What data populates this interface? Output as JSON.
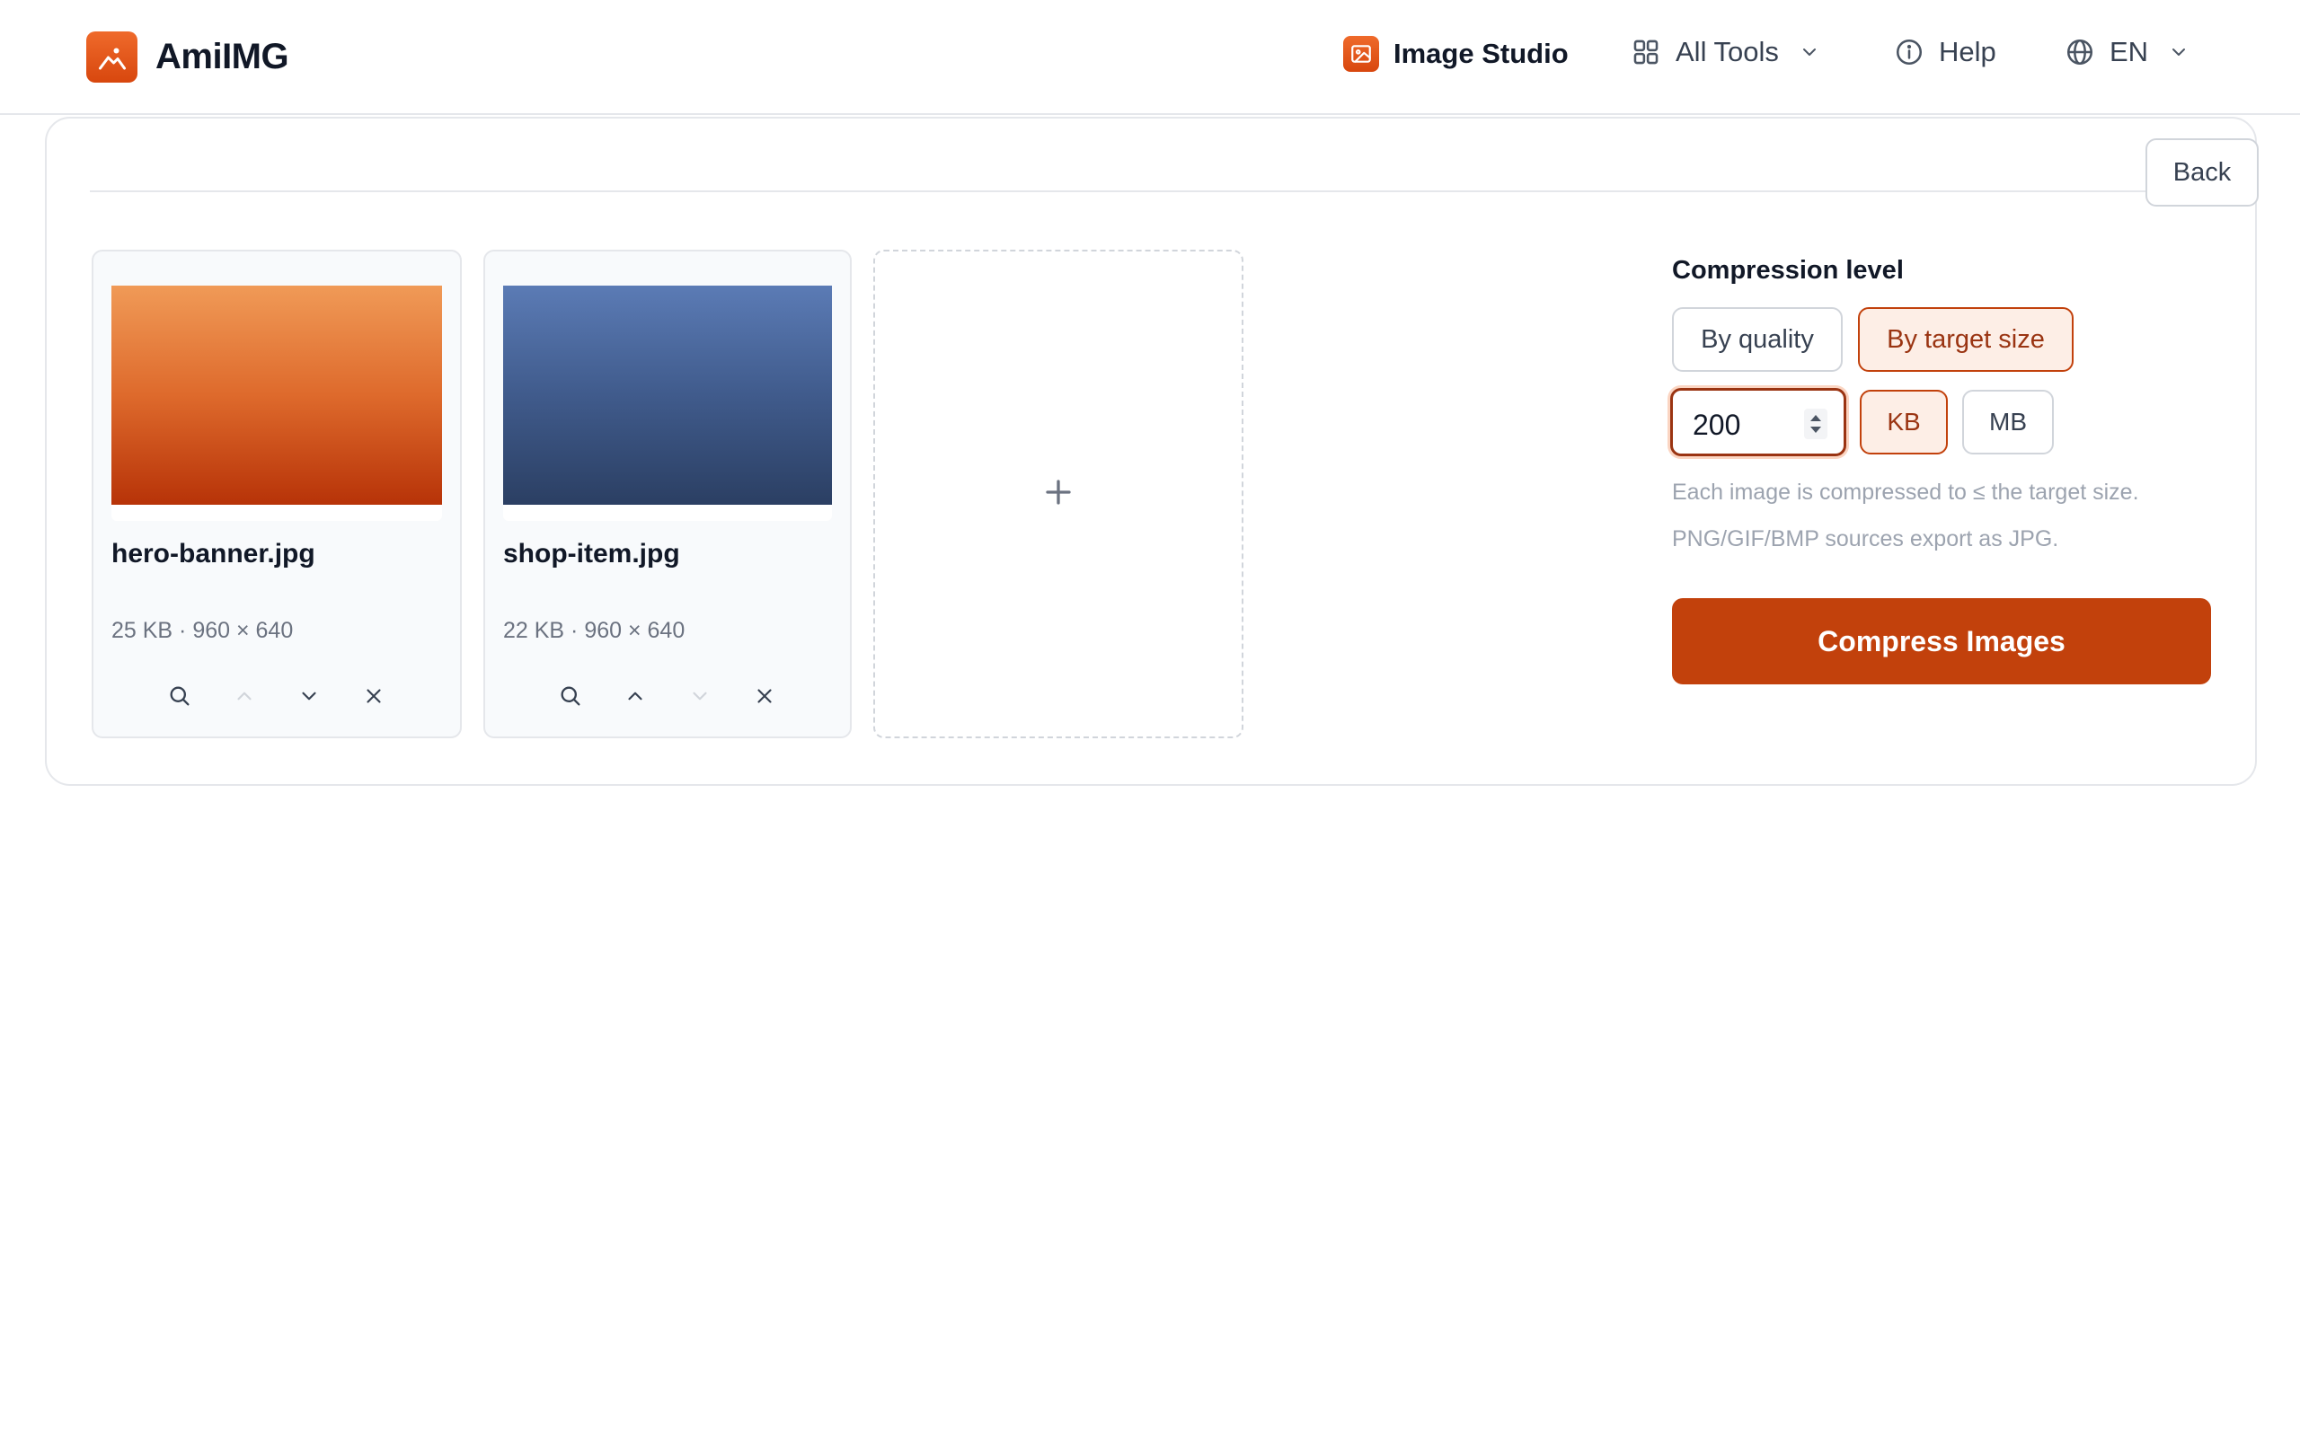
{
  "header": {
    "brand_name": "AmiIMG",
    "nav": {
      "image_studio": "Image Studio",
      "all_tools": "All Tools",
      "help": "Help",
      "language": "EN"
    }
  },
  "card": {
    "back_label": "Back"
  },
  "images": [
    {
      "name": "hero-banner.jpg",
      "meta": "25 KB · 960 × 640"
    },
    {
      "name": "shop-item.jpg",
      "meta": "22 KB · 960 × 640"
    }
  ],
  "add_tile": {
    "icon": "plus-icon"
  },
  "settings": {
    "title": "Compression level",
    "mode_quality": "By quality",
    "mode_target": "By target size",
    "target_value": "200",
    "unit_kb": "KB",
    "unit_mb": "MB",
    "hint_1": "Each image is compressed to ≤ the target size.",
    "hint_2": "PNG/GIF/BMP sources export as JPG.",
    "compress_label": "Compress Images"
  },
  "colors": {
    "accent": "#c2410c",
    "accent_light": "#fdeee6",
    "border": "#e5e7eb",
    "muted_text": "#9ca3af"
  }
}
